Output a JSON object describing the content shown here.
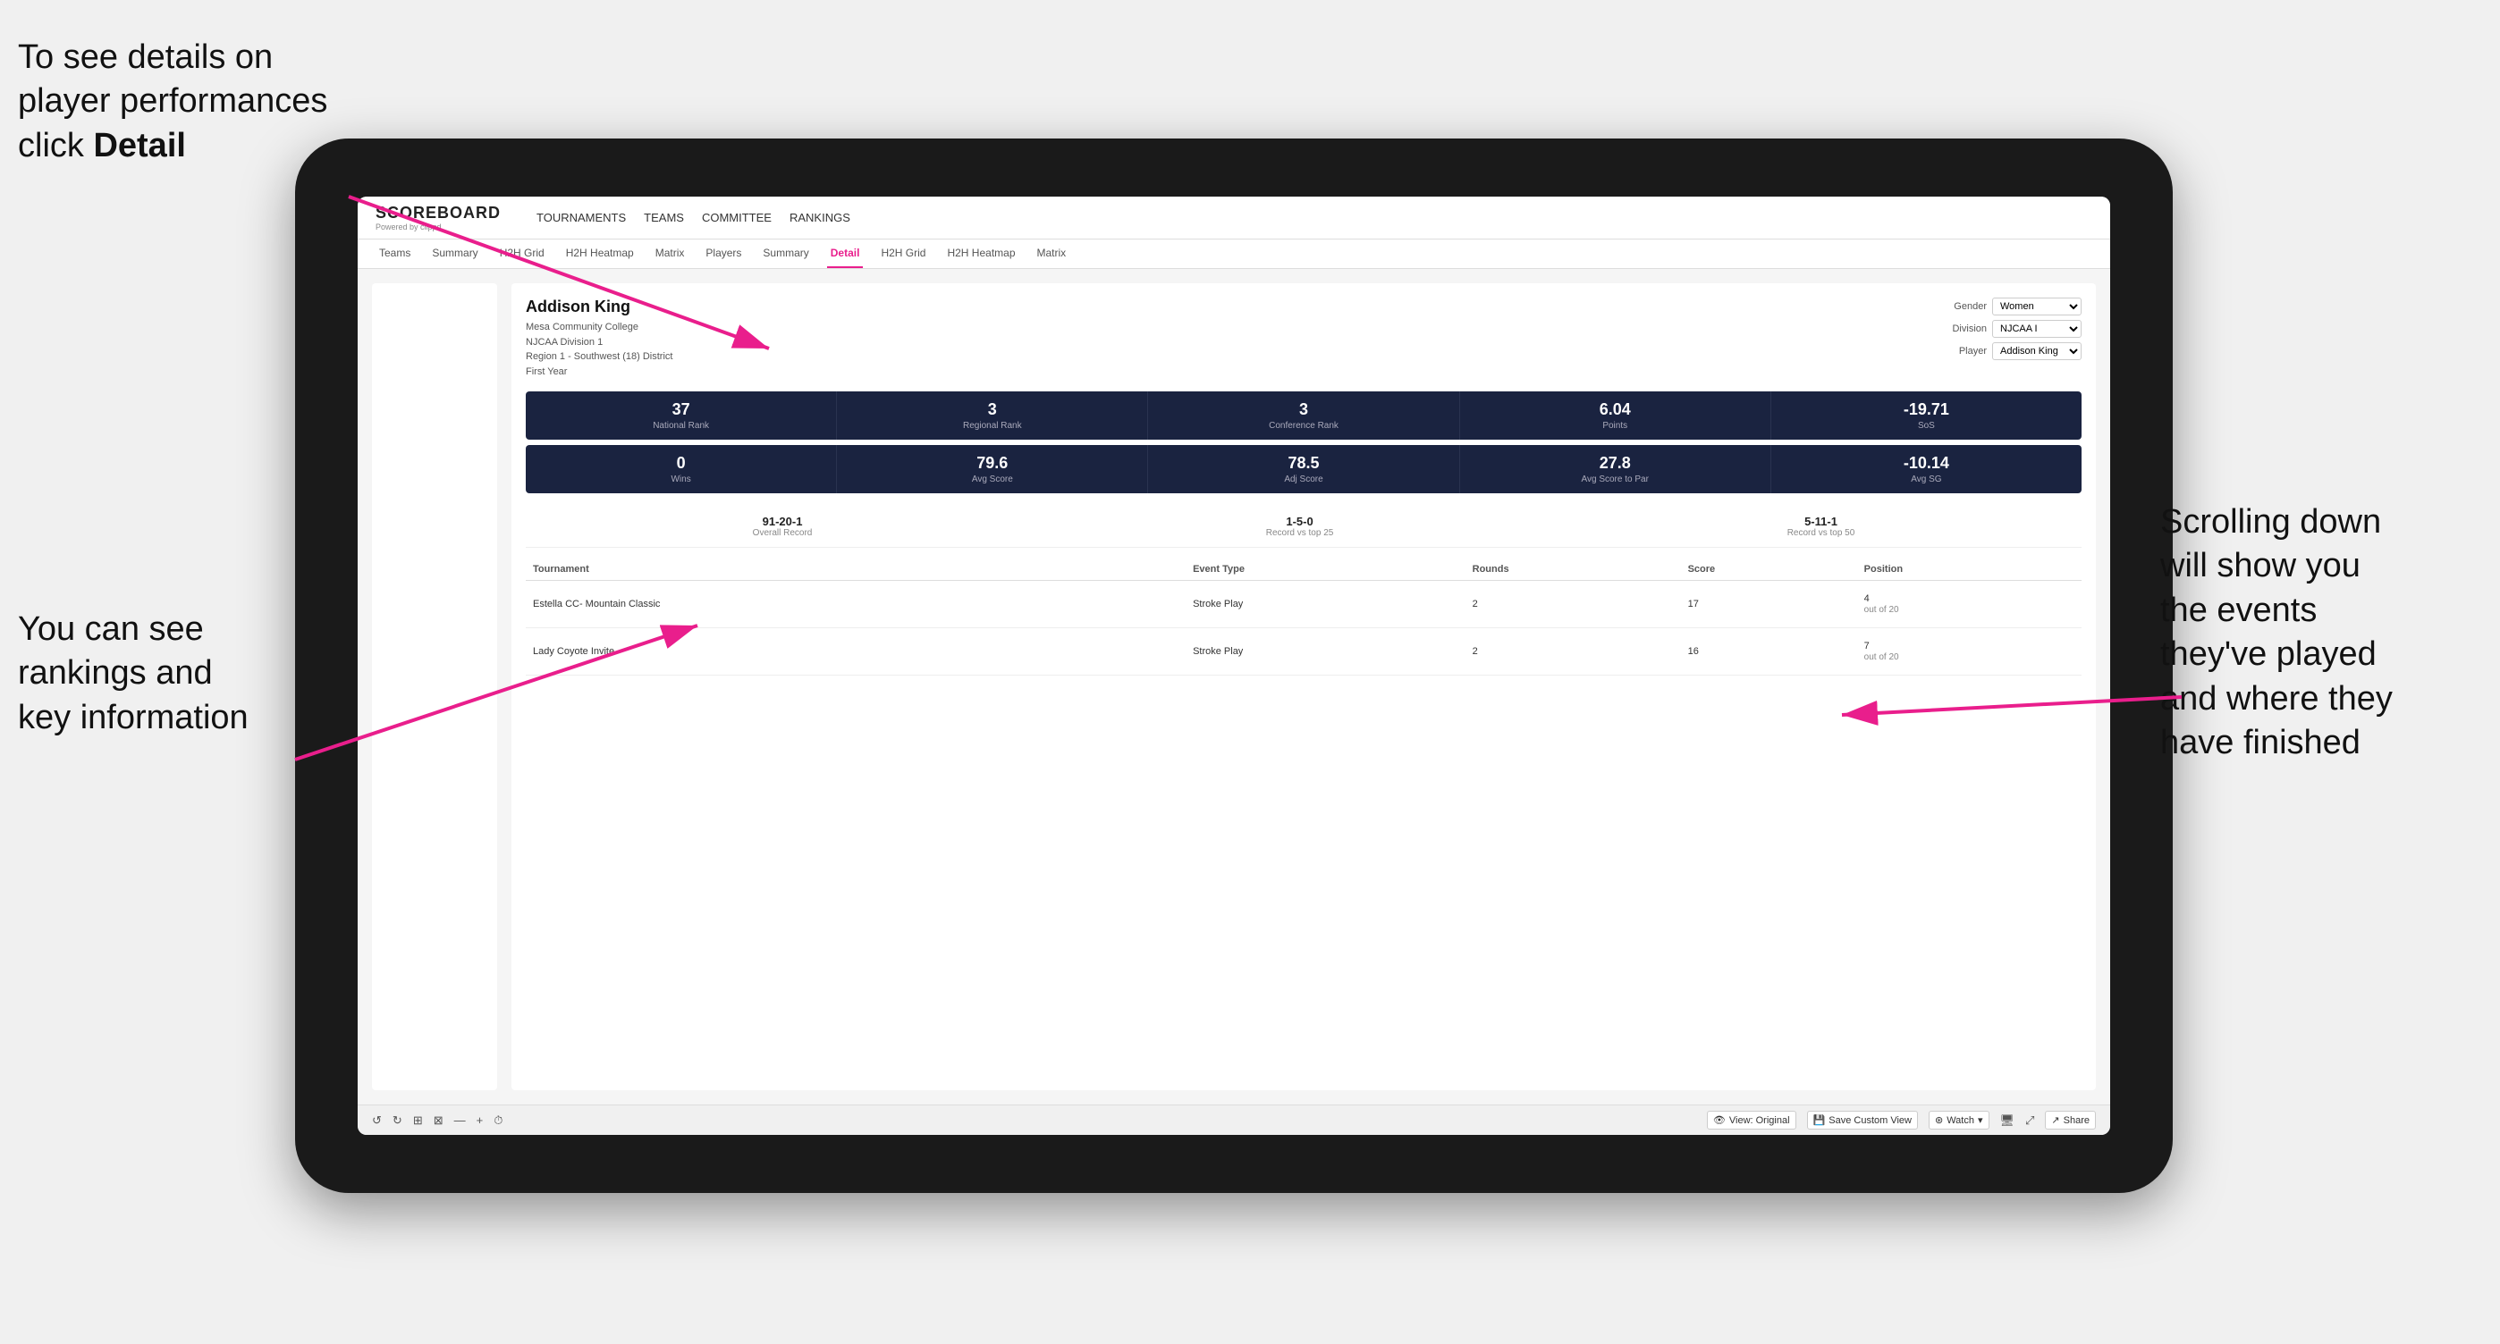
{
  "annotations": {
    "topleft": {
      "line1": "To see details on",
      "line2": "player performances",
      "line3_prefix": "click ",
      "line3_bold": "Detail"
    },
    "bottomleft": {
      "line1": "You can see",
      "line2": "rankings and",
      "line3": "key information"
    },
    "right": {
      "line1": "Scrolling down",
      "line2": "will show you",
      "line3": "the events",
      "line4": "they've played",
      "line5": "and where they",
      "line6": "have finished"
    }
  },
  "header": {
    "logo_title": "SCOREBOARD",
    "logo_sub": "Powered by clippd",
    "nav": [
      "TOURNAMENTS",
      "TEAMS",
      "COMMITTEE",
      "RANKINGS"
    ]
  },
  "subnav": {
    "tabs": [
      "Teams",
      "Summary",
      "H2H Grid",
      "H2H Heatmap",
      "Matrix",
      "Players",
      "Summary",
      "Detail",
      "H2H Grid",
      "H2H Heatmap",
      "Matrix"
    ],
    "active": "Detail"
  },
  "player": {
    "name": "Addison King",
    "college": "Mesa Community College",
    "division": "NJCAA Division 1",
    "region": "Region 1 - Southwest (18) District",
    "year": "First Year",
    "filters": {
      "gender_label": "Gender",
      "gender_value": "Women",
      "division_label": "Division",
      "division_value": "NJCAA I",
      "player_label": "Player",
      "player_value": "Addison King"
    }
  },
  "stats_row1": [
    {
      "value": "37",
      "label": "National Rank"
    },
    {
      "value": "3",
      "label": "Regional Rank"
    },
    {
      "value": "3",
      "label": "Conference Rank"
    },
    {
      "value": "6.04",
      "label": "Points"
    },
    {
      "value": "-19.71",
      "label": "SoS"
    }
  ],
  "stats_row2": [
    {
      "value": "0",
      "label": "Wins"
    },
    {
      "value": "79.6",
      "label": "Avg Score"
    },
    {
      "value": "78.5",
      "label": "Adj Score"
    },
    {
      "value": "27.8",
      "label": "Avg Score to Par"
    },
    {
      "value": "-10.14",
      "label": "Avg SG"
    }
  ],
  "records": [
    {
      "value": "91-20-1",
      "label": "Overall Record"
    },
    {
      "value": "1-5-0",
      "label": "Record vs top 25"
    },
    {
      "value": "5-11-1",
      "label": "Record vs top 50"
    }
  ],
  "table": {
    "headers": [
      "Tournament",
      "",
      "Event Type",
      "Rounds",
      "Score",
      "Position"
    ],
    "rows": [
      {
        "tournament": "Estella CC- Mountain Classic",
        "event_type": "Stroke Play",
        "rounds": "2",
        "score": "17",
        "position": "4",
        "position_sub": "out of 20"
      },
      {
        "tournament": "Lady Coyote Invite",
        "event_type": "Stroke Play",
        "rounds": "2",
        "score": "16",
        "position": "7",
        "position_sub": "out of 20"
      }
    ]
  },
  "toolbar": {
    "buttons": [
      "View: Original",
      "Save Custom View",
      "Watch",
      "Share"
    ],
    "icons": [
      "↺",
      "↻",
      "⊞",
      "⊠",
      "—",
      "+",
      "⏱",
      "👁"
    ]
  }
}
